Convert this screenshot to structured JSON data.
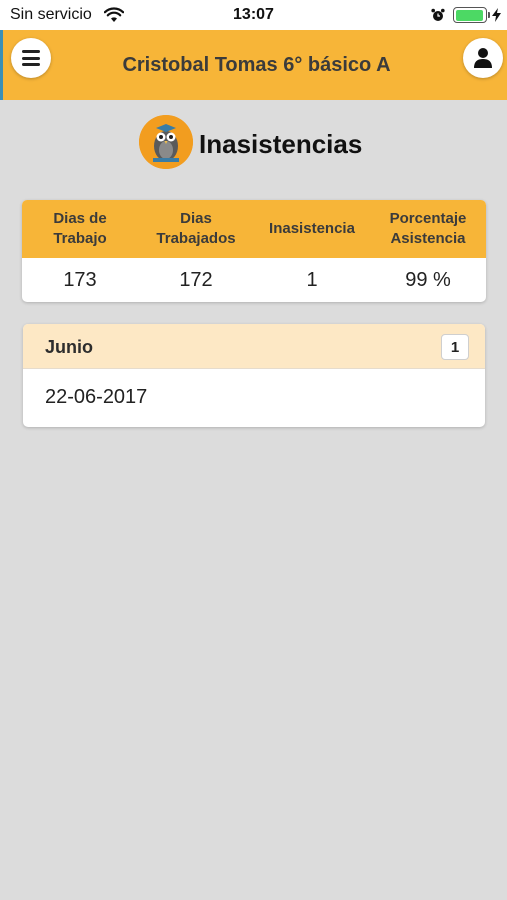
{
  "status_bar": {
    "carrier": "Sin servicio",
    "time": "13:07",
    "battery_level": 0.95,
    "icons": [
      "wifi-icon",
      "alarm-icon",
      "battery-icon",
      "charging-bolt-icon"
    ]
  },
  "header": {
    "title": "Cristobal Tomas 6° básico A",
    "menu_icon": "hamburger-menu-icon",
    "profile_icon": "user-profile-icon",
    "bg_color": "#f7b538"
  },
  "section": {
    "title": "Inasistencias",
    "logo_icon": "owl-logo-icon"
  },
  "stats": {
    "headers": [
      "Dias de\nTrabajo",
      "Dias\nTrabajados",
      "Inasistencia",
      "Porcentaje\nAsistencia"
    ],
    "values": [
      "173",
      "172",
      "1",
      "99 %"
    ]
  },
  "absences": [
    {
      "month": "Junio",
      "count": "1",
      "dates": [
        "22-06-2017"
      ]
    }
  ]
}
